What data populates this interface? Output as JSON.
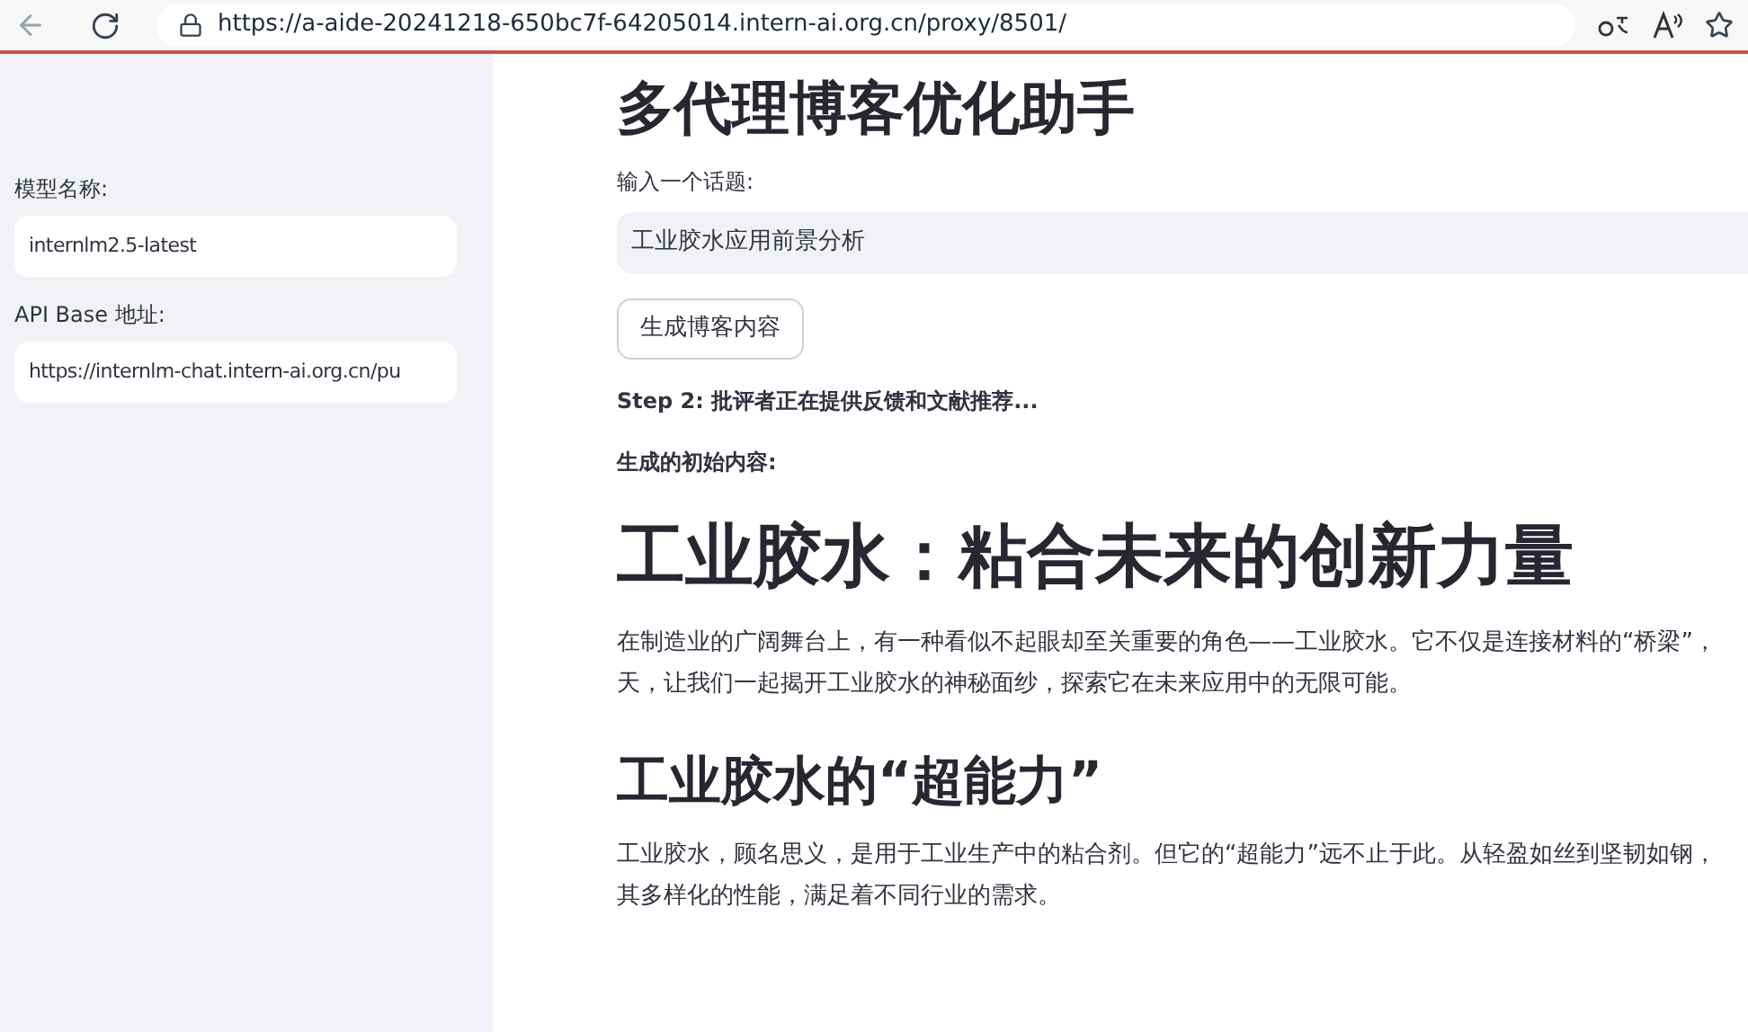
{
  "browser": {
    "url": "https://a-aide-20241218-650bc7f-64205014.intern-ai.org.cn/proxy/8501/"
  },
  "sidebar": {
    "fields": [
      {
        "label": "模型名称:",
        "value": "internlm2.5-latest"
      },
      {
        "label": "API Base 地址:",
        "value": "https://internlm-chat.intern-ai.org.cn/pu"
      }
    ]
  },
  "main": {
    "title": "多代理博客优化助手",
    "topic_field": {
      "label": "输入一个话题:",
      "value": "工业胶水应用前景分析"
    },
    "generate_button": "生成博客内容",
    "status": "Step 2: 批评者正在提供反馈和文献推荐...",
    "initial_label": "生成的初始内容:",
    "blocks": [
      {
        "kind": "h1",
        "text": "工业胶水：粘合未来的创新力量"
      },
      {
        "kind": "p",
        "lines": [
          "在制造业的广阔舞台上，有一种看似不起眼却至关重要的角色——工业胶水。它不仅是连接材料的“桥梁”，",
          "天，让我们一起揭开工业胶水的神秘面纱，探索它在未来应用中的无限可能。"
        ]
      },
      {
        "kind": "h2",
        "text": "工业胶水的“超能力”"
      },
      {
        "kind": "p",
        "lines": [
          "工业胶水，顾名思义，是用于工业生产中的粘合剂。但它的“超能力”远不止于此。从轻盈如丝到坚韧如钢，",
          "其多样化的性能，满足着不同行业的需求。"
        ]
      }
    ]
  }
}
